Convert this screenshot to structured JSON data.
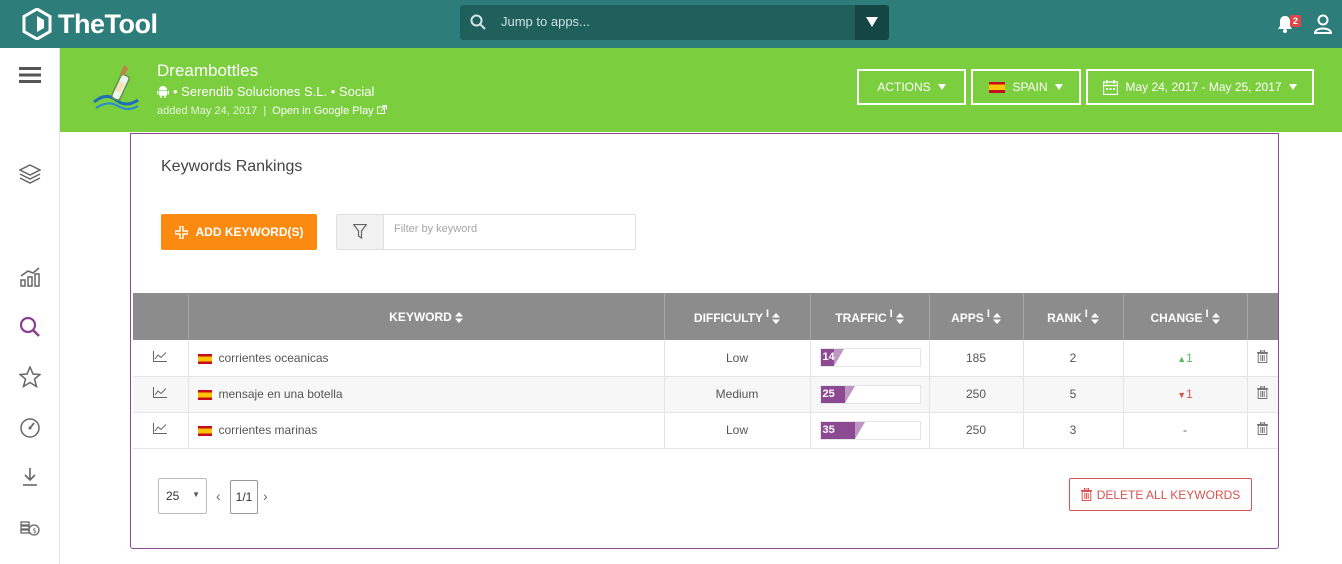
{
  "topbar": {
    "brand": "TheTool",
    "search_placeholder": "Jump to apps...",
    "notification_count": "2"
  },
  "app": {
    "name": "Dreambottles",
    "developer_line": "• Serendib Soluciones S.L. • Social",
    "added": "added May 24, 2017",
    "separator": "|",
    "store_link": "Open in Google Play"
  },
  "header_buttons": {
    "actions": "ACTIONS",
    "country": "SPAIN",
    "date_range": "May 24, 2017 - May 25, 2017"
  },
  "card": {
    "title": "Keywords Rankings",
    "add_button": "ADD KEYWORD(S)",
    "filter_placeholder": "Filter by keyword"
  },
  "table": {
    "columns": {
      "keyword": "KEYWORD",
      "difficulty": "DIFFICULTY",
      "traffic": "TRAFFIC",
      "apps": "APPS",
      "rank": "RANK",
      "change": "CHANGE",
      "info": "i"
    },
    "rows": [
      {
        "keyword": "corrientes oceanicas",
        "difficulty": "Low",
        "traffic": "14",
        "traffic_pct": 14,
        "apps": "185",
        "rank": "2",
        "change": "1",
        "change_dir": "up"
      },
      {
        "keyword": "mensaje en una botella",
        "difficulty": "Medium",
        "traffic": "25",
        "traffic_pct": 25,
        "apps": "250",
        "rank": "5",
        "change": "1",
        "change_dir": "down"
      },
      {
        "keyword": "corrientes marinas",
        "difficulty": "Low",
        "traffic": "35",
        "traffic_pct": 35,
        "apps": "250",
        "rank": "3",
        "change": "-",
        "change_dir": "none"
      }
    ]
  },
  "pager": {
    "page_size": "25",
    "page": "1/1",
    "delete_all": "DELETE ALL KEYWORDS"
  },
  "colors": {
    "topbar": "#2d7d7a",
    "appbar": "#7bce3e",
    "accent_orange": "#fb8a10",
    "traffic_purple": "#8c4a92",
    "danger": "#d9534f"
  }
}
